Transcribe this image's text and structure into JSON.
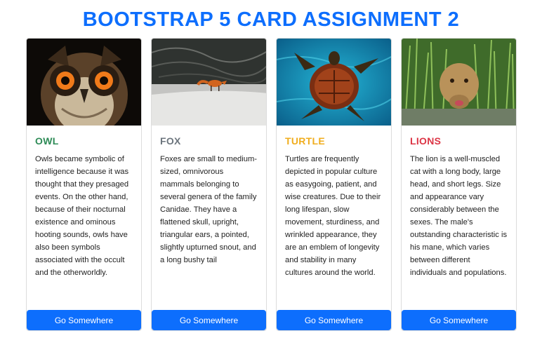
{
  "page": {
    "title": "BOOTSTRAP 5 CARD ASSIGNMENT 2"
  },
  "cards": [
    {
      "title": "OWL",
      "title_color": "#2e8b57",
      "image_icon": "owl-photo",
      "text": "Owls became symbolic of intelligence because it was thought that they presaged events. On the other hand, because of their nocturnal existence and ominous hooting sounds, owls have also been symbols associated with the occult and the otherworldly.",
      "button_label": "Go Somewhere"
    },
    {
      "title": "FOX",
      "title_color": "#6c757d",
      "image_icon": "fox-photo",
      "text": "Foxes are small to medium-sized, omnivorous mammals belonging to several genera of the family Canidae. They have a flattened skull, upright, triangular ears, a pointed, slightly upturned snout, and a long bushy tail",
      "button_label": "Go Somewhere"
    },
    {
      "title": "TURTLE",
      "title_color": "#f0ad1e",
      "image_icon": "turtle-photo",
      "text": "Turtles are frequently depicted in popular culture as easygoing, patient, and wise creatures. Due to their long lifespan, slow movement, sturdiness, and wrinkled appearance, they are an emblem of longevity and stability in many cultures around the world.",
      "button_label": "Go Somewhere"
    },
    {
      "title": "LIONS",
      "title_color": "#dc3545",
      "image_icon": "lion-photo",
      "text": "The lion is a well-muscled cat with a long body, large head, and short legs. Size and appearance vary considerably between the sexes. The male's outstanding characteristic is his mane, which varies between different individuals and populations.",
      "button_label": "Go Somewhere"
    }
  ],
  "colors": {
    "accent": "#0d6efd"
  }
}
